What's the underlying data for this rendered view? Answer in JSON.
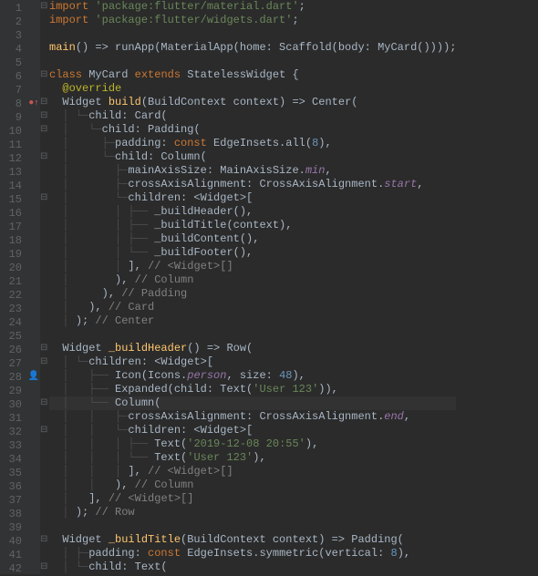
{
  "lines": [
    {
      "n": 1,
      "fold": "⊟",
      "t": "<span class='kw'>import</span> <span class='str'>'package:flutter/material.dart'</span>;"
    },
    {
      "n": 2,
      "fold": "",
      "t": "<span class='kw'>import</span> <span class='str'>'package:flutter/widgets.dart'</span>;"
    },
    {
      "n": 3,
      "fold": "",
      "t": ""
    },
    {
      "n": 4,
      "fold": "",
      "t": "<span class='fn'>main</span>() =&gt; runApp(MaterialApp(home: Scaffold(body: MyCard())));"
    },
    {
      "n": 5,
      "fold": "",
      "t": ""
    },
    {
      "n": 6,
      "fold": "⊟",
      "t": "<span class='kw'>class</span> <span class='cls'>MyCard</span> <span class='kw'>extends</span> <span class='cls'>StatelessWidget</span> {"
    },
    {
      "n": 7,
      "fold": "",
      "t": "  <span class='ann'>@override</span>"
    },
    {
      "n": 8,
      "fold": "⊟",
      "mark": "bp",
      "t": "  Widget <span class='fn'>build</span>(BuildContext context) =&gt; Center("
    },
    {
      "n": 9,
      "fold": "⊟",
      "t": "  <span class='guide'>│ └─</span>child: Card("
    },
    {
      "n": 10,
      "fold": "⊟",
      "t": "  <span class='guide'>│   └─</span>child: Padding("
    },
    {
      "n": 11,
      "fold": "",
      "t": "  <span class='guide'>│     ├─</span>padding: <span class='kw'>const</span> EdgeInsets.all(<span class='num'>8</span>),"
    },
    {
      "n": 12,
      "fold": "⊟",
      "t": "  <span class='guide'>│     └─</span>child: Column("
    },
    {
      "n": 13,
      "fold": "",
      "t": "  <span class='guide'>│       ├─</span>mainAxisSize: MainAxisSize.<span class='id'>min</span>,"
    },
    {
      "n": 14,
      "fold": "",
      "t": "  <span class='guide'>│       ├─</span>crossAxisAlignment: CrossAxisAlignment.<span class='id'>start</span>,"
    },
    {
      "n": 15,
      "fold": "⊟",
      "t": "  <span class='guide'>│       └─</span>children: &lt;Widget&gt;["
    },
    {
      "n": 16,
      "fold": "",
      "t": "  <span class='guide'>│       │ ├──</span> _buildHeader(),"
    },
    {
      "n": 17,
      "fold": "",
      "t": "  <span class='guide'>│       │ ├──</span> _buildTitle(context),"
    },
    {
      "n": 18,
      "fold": "",
      "t": "  <span class='guide'>│       │ ├──</span> _buildContent(),"
    },
    {
      "n": 19,
      "fold": "",
      "t": "  <span class='guide'>│       │ └──</span> _buildFooter(),"
    },
    {
      "n": 20,
      "fold": "",
      "t": "  <span class='guide'>│       │ </span>], <span class='cmt'>// &lt;Widget&gt;[]</span>"
    },
    {
      "n": 21,
      "fold": "",
      "t": "  <span class='guide'>│       </span>), <span class='cmt'>// Column</span>"
    },
    {
      "n": 22,
      "fold": "",
      "t": "  <span class='guide'>│     </span>), <span class='cmt'>// Padding</span>"
    },
    {
      "n": 23,
      "fold": "",
      "t": "  <span class='guide'>│   </span>), <span class='cmt'>// Card</span>"
    },
    {
      "n": 24,
      "fold": "",
      "t": "  <span class='guide'>│ </span>); <span class='cmt'>// Center</span>"
    },
    {
      "n": 25,
      "fold": "",
      "t": ""
    },
    {
      "n": 26,
      "fold": "⊟",
      "t": "  Widget <span class='fn'>_buildHeader</span>() =&gt; Row("
    },
    {
      "n": 27,
      "fold": "⊟",
      "t": "  <span class='guide'>│ └─</span>children: &lt;Widget&gt;["
    },
    {
      "n": 28,
      "fold": "",
      "mark": "user",
      "t": "  <span class='guide'>│   ├──</span> Icon(Icons.<span class='id'>person</span>, size: <span class='num'>48</span>),"
    },
    {
      "n": 29,
      "fold": "",
      "t": "  <span class='guide'>│   ├──</span> Expanded(child: Text(<span class='str'>'User 123'</span>)),"
    },
    {
      "n": 30,
      "fold": "⊟",
      "hl": true,
      "t": "  <span class='guide'>│   └──</span> Column("
    },
    {
      "n": 31,
      "fold": "",
      "t": "  <span class='guide'>│   │   ├─</span>crossAxisAlignment: CrossAxisAlignment.<span class='id'>end</span>,"
    },
    {
      "n": 32,
      "fold": "⊟",
      "t": "  <span class='guide'>│   │   └─</span>children: &lt;Widget&gt;["
    },
    {
      "n": 33,
      "fold": "",
      "t": "  <span class='guide'>│   │   │ ├──</span> Text(<span class='str'>'2019-12-08 20:55'</span>),"
    },
    {
      "n": 34,
      "fold": "",
      "t": "  <span class='guide'>│   │   │ └──</span> Text(<span class='str'>'User 123'</span>),"
    },
    {
      "n": 35,
      "fold": "",
      "t": "  <span class='guide'>│   │   │ </span>], <span class='cmt'>// &lt;Widget&gt;[]</span>"
    },
    {
      "n": 36,
      "fold": "",
      "t": "  <span class='guide'>│   │   </span>), <span class='cmt'>// Column</span>"
    },
    {
      "n": 37,
      "fold": "",
      "t": "  <span class='guide'>│   </span>], <span class='cmt'>// &lt;Widget&gt;[]</span>"
    },
    {
      "n": 38,
      "fold": "",
      "t": "  <span class='guide'>│ </span>); <span class='cmt'>// Row</span>"
    },
    {
      "n": 39,
      "fold": "",
      "t": ""
    },
    {
      "n": 40,
      "fold": "⊟",
      "t": "  Widget <span class='fn'>_buildTitle</span>(BuildContext context) =&gt; Padding("
    },
    {
      "n": 41,
      "fold": "",
      "t": "  <span class='guide'>│ ├─</span>padding: <span class='kw'>const</span> EdgeInsets.symmetric(vertical: <span class='num'>8</span>),"
    },
    {
      "n": 42,
      "fold": "⊟",
      "t": "  <span class='guide'>│ └─</span>child: Text("
    }
  ]
}
